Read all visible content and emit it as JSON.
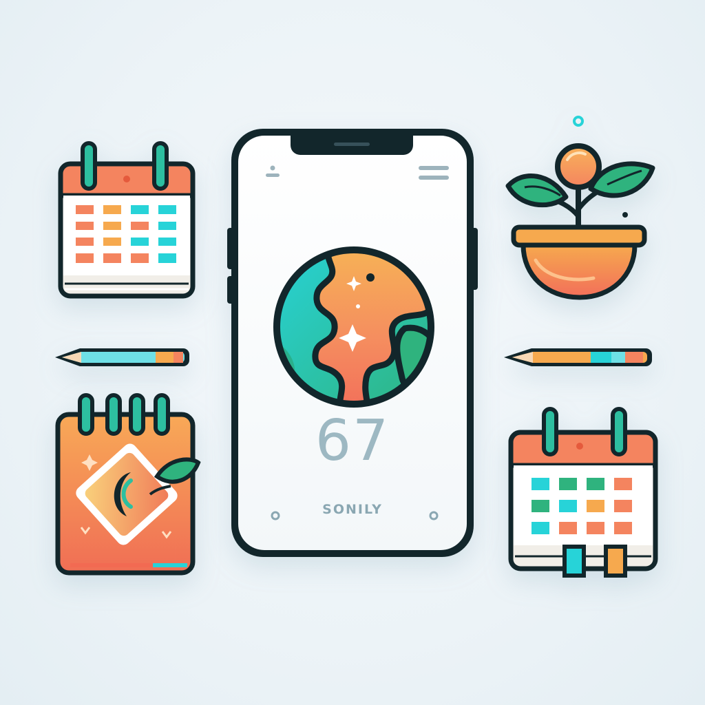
{
  "phone": {
    "display_number": "67",
    "app_label": "SONILY"
  },
  "colors": {
    "outline": "#12262b",
    "coral": "#f4845f",
    "orange": "#f6a94e",
    "teal": "#27d3d8",
    "green": "#2fb37e",
    "screen": "#ffffff",
    "muted_text": "#9db8c2"
  },
  "icons": [
    "calendar-icon",
    "pencil-icon",
    "notebook-icon",
    "plant-pot-icon",
    "globe-icon",
    "calendar-bookmarks-icon"
  ]
}
